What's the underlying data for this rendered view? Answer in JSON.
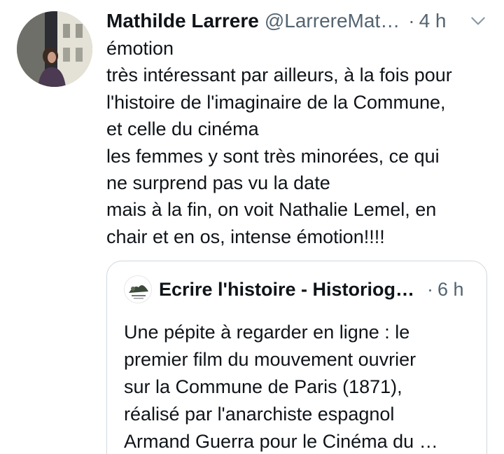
{
  "tweet": {
    "author_name": "Mathilde Larrere",
    "author_handle": "@LarrereMat…",
    "separator": "·",
    "time": "4 h",
    "lines": [
      "émotion",
      "très intéressant par ailleurs, à la fois pour",
      "l'histoire de l'imaginaire de la Commune,",
      "et celle du cinéma",
      "les femmes y sont très minorées, ce qui",
      "ne surprend pas vu la date",
      "mais à la fin, on voit Nathalie Lemel, en",
      "chair et en os, intense émotion!!!!"
    ]
  },
  "quoted_tweet": {
    "author_name": "Ecrire l'histoire - Historiog…",
    "separator": "·",
    "time": "6 h",
    "lines": [
      "Une pépite à regarder en ligne : le",
      "premier film du mouvement ouvrier",
      "sur la Commune de Paris (1871),",
      "réalisé par l'anarchiste espagnol",
      "Armand Guerra pour le Cinéma du …"
    ]
  },
  "icons": {
    "menu": "chevron-down-icon"
  },
  "colors": {
    "text": "#0f1419",
    "secondary": "#536471",
    "border": "#cfd9de"
  }
}
